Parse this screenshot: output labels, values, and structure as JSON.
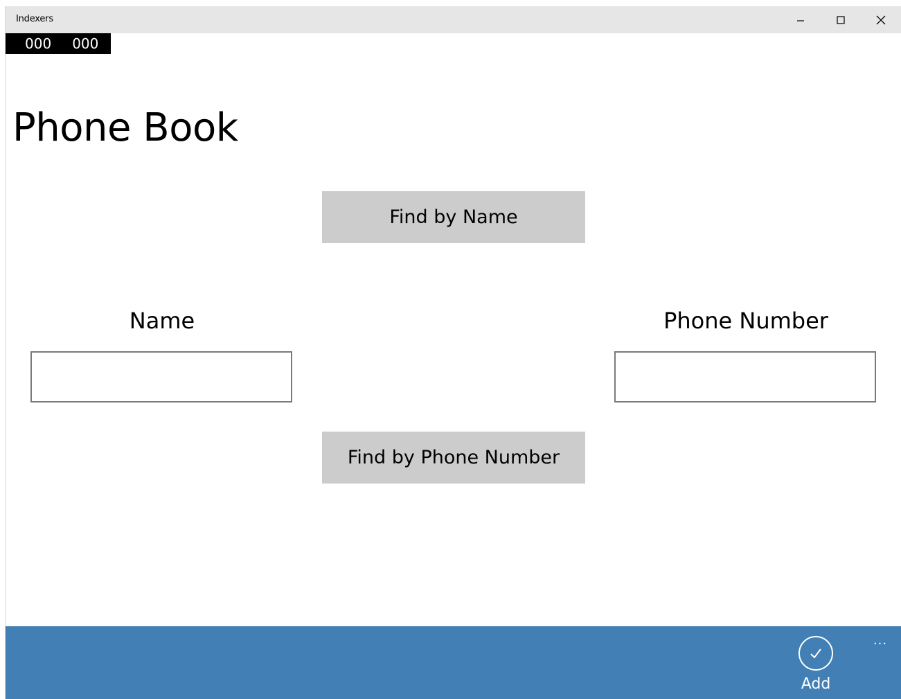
{
  "window": {
    "title": "Indexers"
  },
  "counter": {
    "left": "000",
    "right": "000"
  },
  "page": {
    "title": "Phone Book"
  },
  "buttons": {
    "find_by_name": "Find by Name",
    "find_by_phone": "Find by Phone Number"
  },
  "fields": {
    "name_label": "Name",
    "name_value": "",
    "phone_label": "Phone Number",
    "phone_value": ""
  },
  "appbar": {
    "add_label": "Add",
    "more_label": "...",
    "color": "#427fb4"
  }
}
